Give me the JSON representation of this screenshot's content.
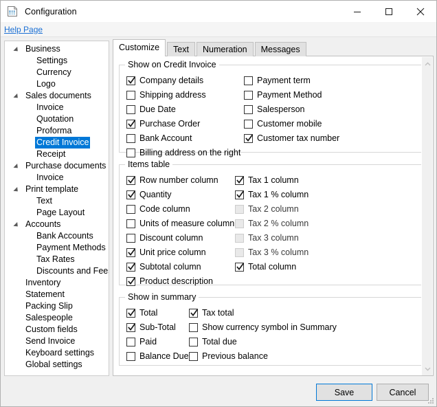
{
  "window": {
    "title": "Configuration",
    "icon": "document-spreadsheet-icon",
    "minimize_label": "Minimize",
    "maximize_label": "Maximize",
    "close_label": "Close"
  },
  "help": {
    "link_label": "Help Page"
  },
  "sidebar": {
    "items": [
      {
        "label": "Business",
        "level": 0,
        "expandable": true,
        "selected": false
      },
      {
        "label": "Settings",
        "level": 1,
        "expandable": false,
        "selected": false
      },
      {
        "label": "Currency",
        "level": 1,
        "expandable": false,
        "selected": false
      },
      {
        "label": "Logo",
        "level": 1,
        "expandable": false,
        "selected": false
      },
      {
        "label": "Sales documents",
        "level": 0,
        "expandable": true,
        "selected": false
      },
      {
        "label": "Invoice",
        "level": 1,
        "expandable": false,
        "selected": false
      },
      {
        "label": "Quotation",
        "level": 1,
        "expandable": false,
        "selected": false
      },
      {
        "label": "Proforma",
        "level": 1,
        "expandable": false,
        "selected": false
      },
      {
        "label": "Credit Invoice",
        "level": 1,
        "expandable": false,
        "selected": true
      },
      {
        "label": "Receipt",
        "level": 1,
        "expandable": false,
        "selected": false
      },
      {
        "label": "Purchase documents",
        "level": 0,
        "expandable": true,
        "selected": false
      },
      {
        "label": "Invoice",
        "level": 1,
        "expandable": false,
        "selected": false
      },
      {
        "label": "Print template",
        "level": 0,
        "expandable": true,
        "selected": false
      },
      {
        "label": "Text",
        "level": 1,
        "expandable": false,
        "selected": false
      },
      {
        "label": "Page Layout",
        "level": 1,
        "expandable": false,
        "selected": false
      },
      {
        "label": "Accounts",
        "level": 0,
        "expandable": true,
        "selected": false
      },
      {
        "label": "Bank Accounts",
        "level": 1,
        "expandable": false,
        "selected": false
      },
      {
        "label": "Payment Methods",
        "level": 1,
        "expandable": false,
        "selected": false
      },
      {
        "label": "Tax Rates",
        "level": 1,
        "expandable": false,
        "selected": false
      },
      {
        "label": "Discounts and Fees",
        "level": 1,
        "expandable": false,
        "selected": false
      },
      {
        "label": "Inventory",
        "level": 0,
        "expandable": false,
        "selected": false
      },
      {
        "label": "Statement",
        "level": 0,
        "expandable": false,
        "selected": false
      },
      {
        "label": "Packing Slip",
        "level": 0,
        "expandable": false,
        "selected": false
      },
      {
        "label": "Salespeople",
        "level": 0,
        "expandable": false,
        "selected": false
      },
      {
        "label": "Custom fields",
        "level": 0,
        "expandable": false,
        "selected": false
      },
      {
        "label": "Send Invoice",
        "level": 0,
        "expandable": false,
        "selected": false
      },
      {
        "label": "Keyboard settings",
        "level": 0,
        "expandable": false,
        "selected": false
      },
      {
        "label": "Global settings",
        "level": 0,
        "expandable": false,
        "selected": false
      }
    ]
  },
  "tabs": [
    {
      "label": "Customize",
      "active": true
    },
    {
      "label": "Text",
      "active": false
    },
    {
      "label": "Numeration",
      "active": false
    },
    {
      "label": "Messages",
      "active": false
    }
  ],
  "groups": [
    {
      "legend": "Show on Credit Invoice",
      "name": "show-on-credit-invoice",
      "items": [
        {
          "label": "Company details",
          "checked": true,
          "disabled": false,
          "col": 0,
          "row": 0
        },
        {
          "label": "Shipping address",
          "checked": false,
          "disabled": false,
          "col": 0,
          "row": 1
        },
        {
          "label": "Due Date",
          "checked": false,
          "disabled": false,
          "col": 0,
          "row": 2
        },
        {
          "label": "Purchase Order",
          "checked": true,
          "disabled": false,
          "col": 0,
          "row": 3
        },
        {
          "label": "Bank Account",
          "checked": false,
          "disabled": false,
          "col": 0,
          "row": 4
        },
        {
          "label": "Billing address on the right",
          "checked": false,
          "disabled": false,
          "col": 0,
          "row": 5
        },
        {
          "label": "Payment term",
          "checked": false,
          "disabled": false,
          "col": 1,
          "row": 0
        },
        {
          "label": "Payment Method",
          "checked": false,
          "disabled": false,
          "col": 1,
          "row": 1
        },
        {
          "label": "Salesperson",
          "checked": false,
          "disabled": false,
          "col": 1,
          "row": 2
        },
        {
          "label": "Customer mobile",
          "checked": false,
          "disabled": false,
          "col": 1,
          "row": 3
        },
        {
          "label": "Customer tax number",
          "checked": true,
          "disabled": false,
          "col": 1,
          "row": 4
        }
      ]
    },
    {
      "legend": "Items table",
      "name": "items-table",
      "items": [
        {
          "label": "Row number column",
          "checked": true,
          "disabled": false,
          "col": 0,
          "row": 0
        },
        {
          "label": "Quantity",
          "checked": true,
          "disabled": false,
          "col": 0,
          "row": 1
        },
        {
          "label": "Code column",
          "checked": false,
          "disabled": false,
          "col": 0,
          "row": 2
        },
        {
          "label": "Units of measure column",
          "checked": false,
          "disabled": false,
          "col": 0,
          "row": 3
        },
        {
          "label": "Discount column",
          "checked": false,
          "disabled": false,
          "col": 0,
          "row": 4
        },
        {
          "label": "Unit price column",
          "checked": true,
          "disabled": false,
          "col": 0,
          "row": 5
        },
        {
          "label": "Subtotal column",
          "checked": true,
          "disabled": false,
          "col": 0,
          "row": 6
        },
        {
          "label": "Product description",
          "checked": true,
          "disabled": false,
          "col": 0,
          "row": 7
        },
        {
          "label": "Tax 1 column",
          "checked": true,
          "disabled": false,
          "col": 1,
          "row": 0
        },
        {
          "label": "Tax 1 % column",
          "checked": true,
          "disabled": false,
          "col": 1,
          "row": 1
        },
        {
          "label": "Tax 2 column",
          "checked": false,
          "disabled": true,
          "col": 1,
          "row": 2
        },
        {
          "label": "Tax 2 % column",
          "checked": false,
          "disabled": true,
          "col": 1,
          "row": 3
        },
        {
          "label": "Tax 3 column",
          "checked": false,
          "disabled": true,
          "col": 1,
          "row": 4
        },
        {
          "label": "Tax 3 % column",
          "checked": false,
          "disabled": true,
          "col": 1,
          "row": 5
        },
        {
          "label": "Total column",
          "checked": true,
          "disabled": false,
          "col": 1,
          "row": 6
        }
      ]
    },
    {
      "legend": "Show in summary",
      "name": "show-in-summary",
      "items": [
        {
          "label": "Total",
          "checked": true,
          "disabled": false,
          "col": 0,
          "row": 0
        },
        {
          "label": "Sub-Total",
          "checked": true,
          "disabled": false,
          "col": 0,
          "row": 1
        },
        {
          "label": "Paid",
          "checked": false,
          "disabled": false,
          "col": 0,
          "row": 2
        },
        {
          "label": "Balance Due",
          "checked": false,
          "disabled": false,
          "col": 0,
          "row": 3
        },
        {
          "label": "Tax total",
          "checked": true,
          "disabled": false,
          "col": 1,
          "row": 0
        },
        {
          "label": "Show currency symbol in Summary",
          "checked": false,
          "disabled": false,
          "col": 1,
          "row": 1
        },
        {
          "label": "Total due",
          "checked": false,
          "disabled": false,
          "col": 1,
          "row": 2
        },
        {
          "label": "Previous balance",
          "checked": false,
          "disabled": false,
          "col": 1,
          "row": 3
        }
      ]
    }
  ],
  "scrollbar": {
    "up_arrow_icon": "chevron-up-icon",
    "down_arrow_icon": "chevron-down-icon"
  },
  "footer": {
    "save_label": "Save",
    "cancel_label": "Cancel"
  },
  "colors": {
    "accent": "#0078d7",
    "link": "#1a6fd4",
    "window_bg": "#f0f0f0",
    "panel_bg": "#ffffff",
    "group_border": "#d6d6d6",
    "selection": "#0078d7"
  }
}
